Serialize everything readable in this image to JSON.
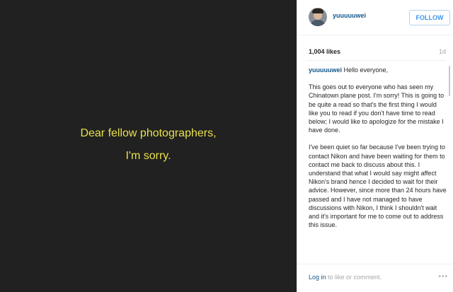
{
  "post_image": {
    "line1": "Dear fellow photographers,",
    "line2": "I'm sorry."
  },
  "header": {
    "username": "yuuuuuwei",
    "follow_label": "FOLLOW"
  },
  "stats": {
    "likes": "1,004 likes",
    "age": "1d"
  },
  "caption": {
    "username": "yuuuuuwei",
    "greeting": "Hello everyone,",
    "paragraph1": "This goes out to everyone who has seen my Chinatown plane post. I'm sorry! This is going to be quite a read so that's the first thing I would like you to read if you don't have time to read below; I would like to apologize for the mistake I have done.",
    "paragraph2": "I've been quiet so far because I've been trying to contact Nikon and have been waiting for them to contact me back to discuss about this. I understand that what I would say might affect Nikon's brand hence I decided to wait for their advice. However, since more than 24 hours have passed and I have not managed to have discussions with Nikon, I think I shouldn't wait and it's important for me to come out to address this issue."
  },
  "footer": {
    "login_label": "Log in",
    "login_suffix": " to like or comment.",
    "more_label": "•••"
  },
  "colors": {
    "image_bg": "#212121",
    "image_text": "#e9e04a",
    "link": "#125688",
    "follow": "#3897f0"
  }
}
